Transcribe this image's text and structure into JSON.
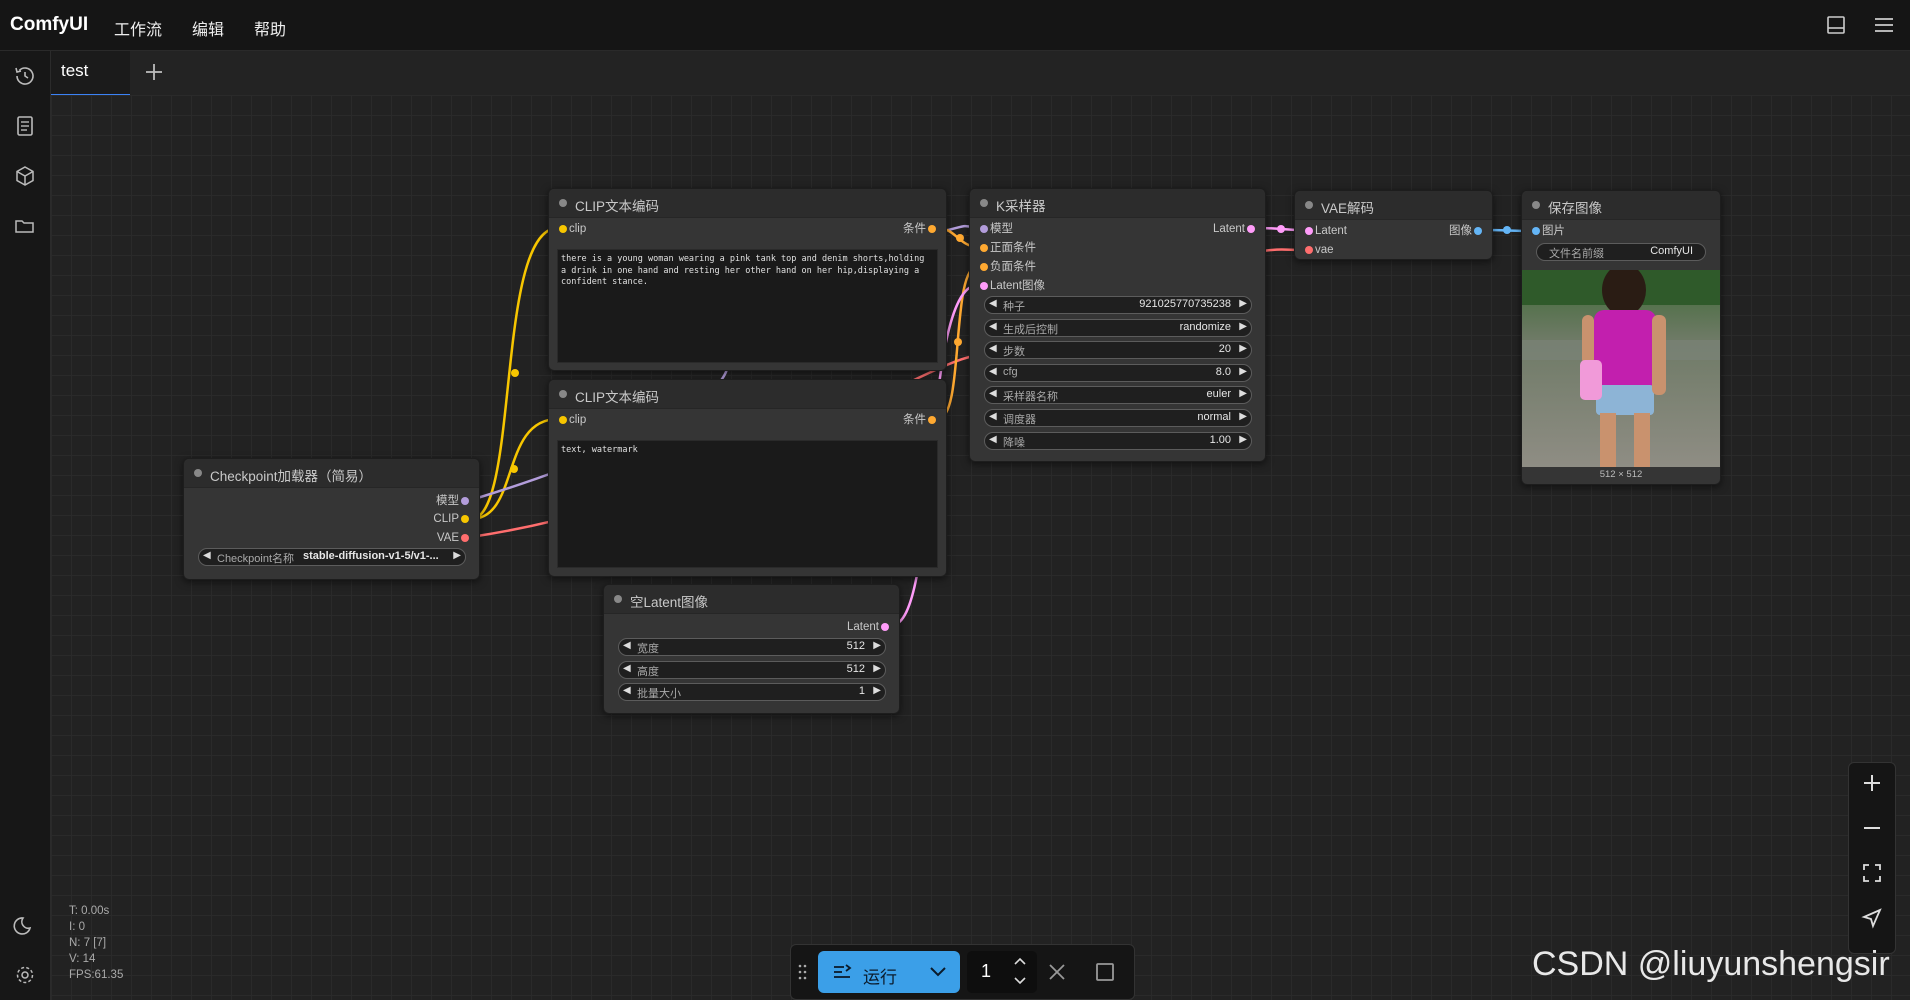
{
  "app": {
    "title": "ComfyUI"
  },
  "menu": [
    "工作流",
    "编辑",
    "帮助"
  ],
  "tab": {
    "label": "test"
  },
  "nodes": {
    "clip_pos": {
      "title": "CLIP文本编码",
      "input": "clip",
      "output": "条件",
      "text": "there is a young woman wearing a pink tank top and denim shorts,holding a drink in one hand and resting her other hand on her hip,displaying a confident stance."
    },
    "clip_neg": {
      "title": "CLIP文本编码",
      "input": "clip",
      "output": "条件",
      "text": "text, watermark"
    },
    "checkpoint": {
      "title": "Checkpoint加载器（简易）",
      "outputs": [
        "模型",
        "CLIP",
        "VAE"
      ],
      "widget": {
        "name": "Checkpoint名称",
        "value": "stable-diffusion-v1-5/v1-..."
      }
    },
    "ksampler": {
      "title": "K采样器",
      "inputs": [
        "模型",
        "正面条件",
        "负面条件",
        "Latent图像"
      ],
      "output": "Latent",
      "widgets": [
        {
          "name": "种子",
          "value": "921025770735238"
        },
        {
          "name": "生成后控制",
          "value": "randomize"
        },
        {
          "name": "步数",
          "value": "20"
        },
        {
          "name": "cfg",
          "value": "8.0"
        },
        {
          "name": "采样器名称",
          "value": "euler"
        },
        {
          "name": "调度器",
          "value": "normal"
        },
        {
          "name": "降噪",
          "value": "1.00"
        }
      ]
    },
    "vae_decode": {
      "title": "VAE解码",
      "inputs": [
        "Latent",
        "vae"
      ],
      "output": "图像"
    },
    "save_image": {
      "title": "保存图像",
      "input": "图片",
      "widget": {
        "name": "文件名前缀",
        "value": "ComfyUI"
      },
      "image_size": "512 × 512"
    },
    "empty_latent": {
      "title": "空Latent图像",
      "output": "Latent",
      "widgets": [
        {
          "name": "宽度",
          "value": "512"
        },
        {
          "name": "高度",
          "value": "512"
        },
        {
          "name": "批量大小",
          "value": "1"
        }
      ]
    }
  },
  "stats": {
    "t": "T: 0.00s",
    "i": "I: 0",
    "n": "N: 7 [7]",
    "v": "V: 14",
    "fps": "FPS:61.35"
  },
  "runbar": {
    "run_label": "运行",
    "quantity": "1"
  },
  "watermark": "CSDN @liuyunshengsir",
  "colors": {
    "clip": "#f7c600",
    "model": "#b39ddb",
    "vae": "#ff6e6e",
    "cond": "#ffa931",
    "latent": "#ff9cf9",
    "image": "#64b5f6",
    "run": "#3b9fe8"
  }
}
